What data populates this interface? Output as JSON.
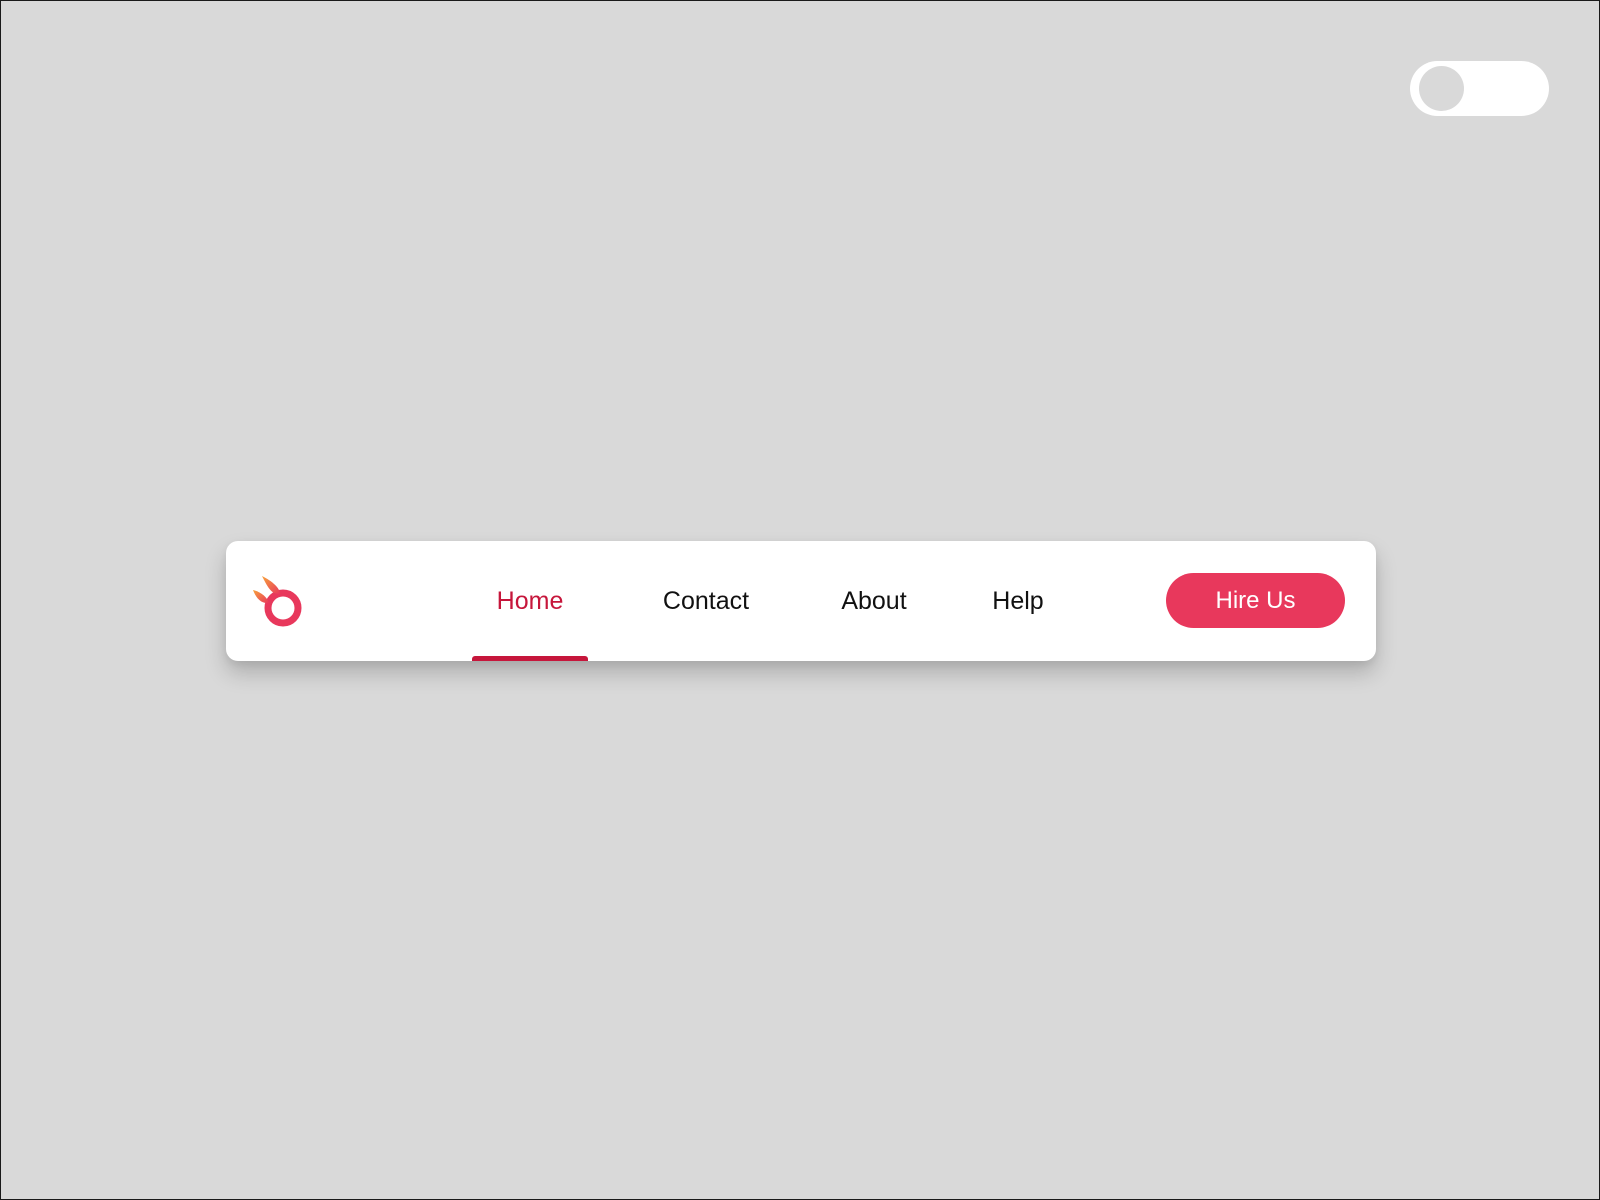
{
  "theme_toggle": {
    "icon": "toggle-switch-icon",
    "state": "off"
  },
  "navbar": {
    "logo": {
      "icon": "flame-ring-logo-icon",
      "gradient_colors": [
        "#f7a23b",
        "#e8385c"
      ]
    },
    "items": [
      {
        "label": "Home",
        "active": true
      },
      {
        "label": "Contact",
        "active": false
      },
      {
        "label": "About",
        "active": false
      },
      {
        "label": "Help",
        "active": false
      }
    ],
    "cta_label": "Hire Us"
  },
  "colors": {
    "page_background": "#d9d9d9",
    "card_background": "#ffffff",
    "accent": "#c6163b",
    "button": "#e8385c",
    "text": "#111111"
  }
}
